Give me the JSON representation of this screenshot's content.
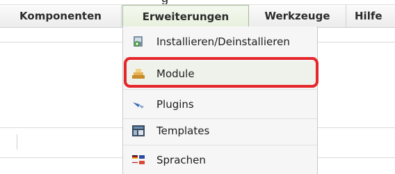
{
  "menubar": {
    "items": [
      {
        "label": "Komponenten"
      },
      {
        "label": "Erweiterungen"
      },
      {
        "label": "Werkzeuge"
      },
      {
        "label": "Hilfe"
      }
    ]
  },
  "dropdown": {
    "items": [
      {
        "label": "Installieren/Deinstallieren",
        "icon": "install-package-icon"
      },
      {
        "label": "Module",
        "icon": "module-icon"
      },
      {
        "label": "Plugins",
        "icon": "plugin-icon"
      },
      {
        "label": "Templates",
        "icon": "template-icon"
      },
      {
        "label": "Sprachen",
        "icon": "language-icon"
      }
    ]
  },
  "colors": {
    "highlight": "#e5262a",
    "active_tab": "#e6efdc"
  }
}
